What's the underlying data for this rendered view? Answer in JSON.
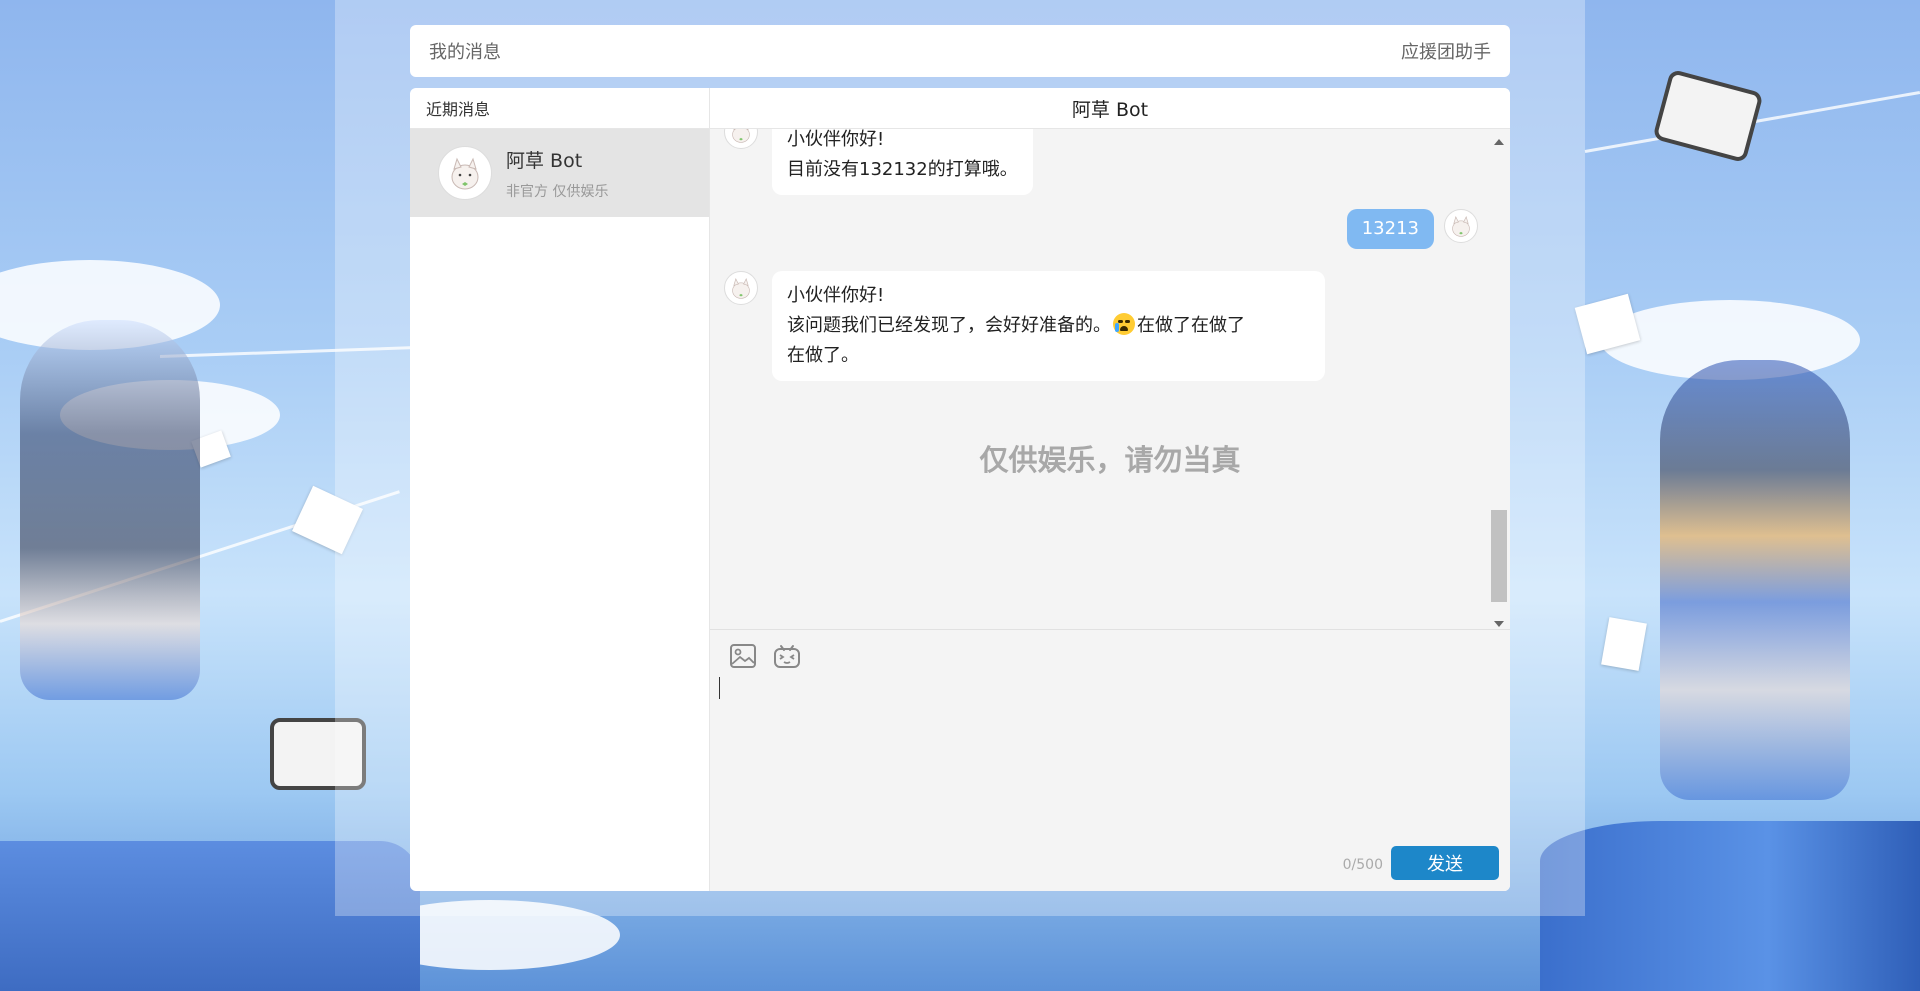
{
  "topbar": {
    "title": "我的消息",
    "right_link": "应援团助手"
  },
  "sidebar": {
    "header": "近期消息",
    "conversations": [
      {
        "name": "阿草 Bot",
        "subtitle": "非官方 仅供娱乐"
      }
    ]
  },
  "chat": {
    "title": "阿草 Bot",
    "messages": [
      {
        "from": "bot",
        "line1": "小伙伴你好!",
        "line2": "目前没有132132的打算哦。"
      },
      {
        "from": "me",
        "text": "13213"
      },
      {
        "from": "bot",
        "line1": "小伙伴你好!",
        "line2_a": "该问题我们已经发现了，会好好准备的。",
        "emoji": "crying-emoji",
        "line2_b": "在做了在做了",
        "line3": "在做了。"
      }
    ],
    "watermark": "仅供娱乐，请勿当真"
  },
  "input": {
    "counter": "0/500",
    "send_label": "发送",
    "tools": [
      "image-icon",
      "emoji-icon"
    ]
  },
  "colors": {
    "accent": "#1d87c9",
    "my_bubble": "#80b9f2"
  }
}
